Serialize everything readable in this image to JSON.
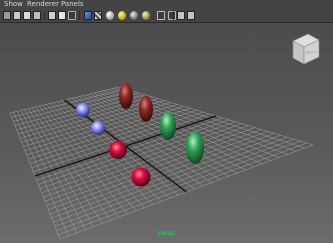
{
  "menubar": {
    "items": [
      {
        "label": "Show"
      },
      {
        "label": "Renderer"
      },
      {
        "label": "Panels"
      }
    ]
  },
  "toolbar": {
    "buttons": [
      {
        "icon": "camera-select-icon"
      },
      {
        "icon": "camera-attributes-icon"
      },
      {
        "icon": "bookmarks-icon"
      },
      {
        "icon": "image-plane-icon"
      },
      {
        "icon": "grid-toggle-icon"
      },
      {
        "icon": "film-gate-icon"
      },
      {
        "icon": "wireframe-icon"
      },
      {
        "icon": "smooth-shade-icon"
      },
      {
        "icon": "textured-icon"
      },
      {
        "icon": "use-all-lights-icon"
      },
      {
        "icon": "shadows-icon"
      },
      {
        "icon": "ambient-occlusion-icon"
      },
      {
        "icon": "motion-blur-icon"
      },
      {
        "icon": "isolate-select-icon"
      },
      {
        "icon": "xray-icon"
      },
      {
        "icon": "xray-joints-icon"
      },
      {
        "icon": "backface-culling-icon"
      }
    ]
  },
  "viewport": {
    "camera_label": "persp",
    "viewcube_face": "RIGHT",
    "grid": {
      "visible": true,
      "color": "#a8a8a8",
      "axis_color": "#111111"
    },
    "background": {
      "top": "#4c4c4c",
      "bottom": "#6c6c6c"
    }
  },
  "colors": {
    "blue_sphere": "#8a8ef0",
    "red_sphere": "#d81040",
    "red_ellipsoid": "#8c2a26",
    "green_ellipsoid": "#2fa656",
    "camera_label": "#14e05a"
  }
}
